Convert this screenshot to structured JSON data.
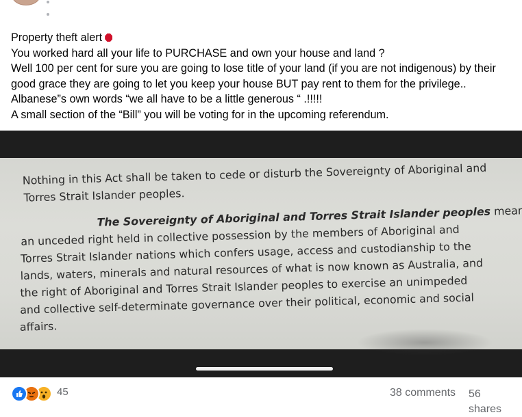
{
  "post": {
    "lines": [
      "Property theft alert",
      "You worked hard all your life to PURCHASE and own your house and land ?",
      "Well 100 per cent for sure you are going to lose title of your land (if you are not indigenous) by their",
      "good grace they are going to let you keep your house BUT  pay rent to them for the privilege..",
      "Albanese”s own words “we all have to be a little generous “ .!!!!!",
      "A small section of the “Bill” you will be voting for in the upcoming referendum."
    ]
  },
  "photo": {
    "doc_lines": [
      "Nothing in this Act shall be taken to cede or disturb the Sovereignty of Aboriginal and",
      "Torres Strait Islander peoples.",
      "The Sovereignty of Aboriginal and Torres Strait Islander peoples",
      " means",
      "an unceded right held in collective possession by the members of Aboriginal and",
      "Torres Strait Islander nations which confers usage, access and custodianship to the",
      "lands, waters, minerals and natural resources of what is now known as Australia, and",
      "the right of Aboriginal and Torres Strait Islander peoples to exercise an unimpeded",
      "and collective self-determinate governance over their political, economic and social",
      "affairs."
    ]
  },
  "footer": {
    "reaction_icons": [
      "like-icon",
      "angry-icon",
      "wow-icon"
    ],
    "reaction_count": "45",
    "comments": "38 comments",
    "shares_count": "56",
    "shares_label": "shares"
  },
  "colors": {
    "stop_icon": "#d0102a",
    "like": "#1877f2",
    "angry": "#e9710f",
    "wow": "#f7b125"
  }
}
